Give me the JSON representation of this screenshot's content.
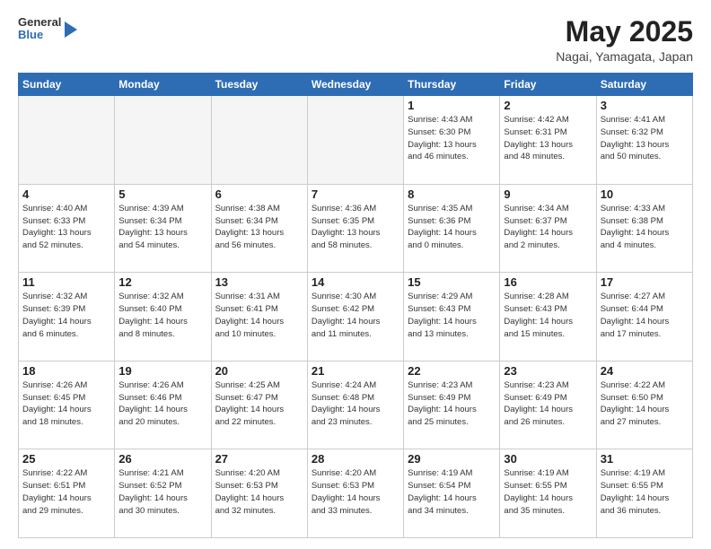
{
  "header": {
    "logo": {
      "line1": "General",
      "line2": "Blue"
    },
    "month": "May 2025",
    "location": "Nagai, Yamagata, Japan"
  },
  "weekdays": [
    "Sunday",
    "Monday",
    "Tuesday",
    "Wednesday",
    "Thursday",
    "Friday",
    "Saturday"
  ],
  "weeks": [
    [
      {
        "day": "",
        "info": ""
      },
      {
        "day": "",
        "info": ""
      },
      {
        "day": "",
        "info": ""
      },
      {
        "day": "",
        "info": ""
      },
      {
        "day": "1",
        "info": "Sunrise: 4:43 AM\nSunset: 6:30 PM\nDaylight: 13 hours\nand 46 minutes."
      },
      {
        "day": "2",
        "info": "Sunrise: 4:42 AM\nSunset: 6:31 PM\nDaylight: 13 hours\nand 48 minutes."
      },
      {
        "day": "3",
        "info": "Sunrise: 4:41 AM\nSunset: 6:32 PM\nDaylight: 13 hours\nand 50 minutes."
      }
    ],
    [
      {
        "day": "4",
        "info": "Sunrise: 4:40 AM\nSunset: 6:33 PM\nDaylight: 13 hours\nand 52 minutes."
      },
      {
        "day": "5",
        "info": "Sunrise: 4:39 AM\nSunset: 6:34 PM\nDaylight: 13 hours\nand 54 minutes."
      },
      {
        "day": "6",
        "info": "Sunrise: 4:38 AM\nSunset: 6:34 PM\nDaylight: 13 hours\nand 56 minutes."
      },
      {
        "day": "7",
        "info": "Sunrise: 4:36 AM\nSunset: 6:35 PM\nDaylight: 13 hours\nand 58 minutes."
      },
      {
        "day": "8",
        "info": "Sunrise: 4:35 AM\nSunset: 6:36 PM\nDaylight: 14 hours\nand 0 minutes."
      },
      {
        "day": "9",
        "info": "Sunrise: 4:34 AM\nSunset: 6:37 PM\nDaylight: 14 hours\nand 2 minutes."
      },
      {
        "day": "10",
        "info": "Sunrise: 4:33 AM\nSunset: 6:38 PM\nDaylight: 14 hours\nand 4 minutes."
      }
    ],
    [
      {
        "day": "11",
        "info": "Sunrise: 4:32 AM\nSunset: 6:39 PM\nDaylight: 14 hours\nand 6 minutes."
      },
      {
        "day": "12",
        "info": "Sunrise: 4:32 AM\nSunset: 6:40 PM\nDaylight: 14 hours\nand 8 minutes."
      },
      {
        "day": "13",
        "info": "Sunrise: 4:31 AM\nSunset: 6:41 PM\nDaylight: 14 hours\nand 10 minutes."
      },
      {
        "day": "14",
        "info": "Sunrise: 4:30 AM\nSunset: 6:42 PM\nDaylight: 14 hours\nand 11 minutes."
      },
      {
        "day": "15",
        "info": "Sunrise: 4:29 AM\nSunset: 6:43 PM\nDaylight: 14 hours\nand 13 minutes."
      },
      {
        "day": "16",
        "info": "Sunrise: 4:28 AM\nSunset: 6:43 PM\nDaylight: 14 hours\nand 15 minutes."
      },
      {
        "day": "17",
        "info": "Sunrise: 4:27 AM\nSunset: 6:44 PM\nDaylight: 14 hours\nand 17 minutes."
      }
    ],
    [
      {
        "day": "18",
        "info": "Sunrise: 4:26 AM\nSunset: 6:45 PM\nDaylight: 14 hours\nand 18 minutes."
      },
      {
        "day": "19",
        "info": "Sunrise: 4:26 AM\nSunset: 6:46 PM\nDaylight: 14 hours\nand 20 minutes."
      },
      {
        "day": "20",
        "info": "Sunrise: 4:25 AM\nSunset: 6:47 PM\nDaylight: 14 hours\nand 22 minutes."
      },
      {
        "day": "21",
        "info": "Sunrise: 4:24 AM\nSunset: 6:48 PM\nDaylight: 14 hours\nand 23 minutes."
      },
      {
        "day": "22",
        "info": "Sunrise: 4:23 AM\nSunset: 6:49 PM\nDaylight: 14 hours\nand 25 minutes."
      },
      {
        "day": "23",
        "info": "Sunrise: 4:23 AM\nSunset: 6:49 PM\nDaylight: 14 hours\nand 26 minutes."
      },
      {
        "day": "24",
        "info": "Sunrise: 4:22 AM\nSunset: 6:50 PM\nDaylight: 14 hours\nand 27 minutes."
      }
    ],
    [
      {
        "day": "25",
        "info": "Sunrise: 4:22 AM\nSunset: 6:51 PM\nDaylight: 14 hours\nand 29 minutes."
      },
      {
        "day": "26",
        "info": "Sunrise: 4:21 AM\nSunset: 6:52 PM\nDaylight: 14 hours\nand 30 minutes."
      },
      {
        "day": "27",
        "info": "Sunrise: 4:20 AM\nSunset: 6:53 PM\nDaylight: 14 hours\nand 32 minutes."
      },
      {
        "day": "28",
        "info": "Sunrise: 4:20 AM\nSunset: 6:53 PM\nDaylight: 14 hours\nand 33 minutes."
      },
      {
        "day": "29",
        "info": "Sunrise: 4:19 AM\nSunset: 6:54 PM\nDaylight: 14 hours\nand 34 minutes."
      },
      {
        "day": "30",
        "info": "Sunrise: 4:19 AM\nSunset: 6:55 PM\nDaylight: 14 hours\nand 35 minutes."
      },
      {
        "day": "31",
        "info": "Sunrise: 4:19 AM\nSunset: 6:55 PM\nDaylight: 14 hours\nand 36 minutes."
      }
    ]
  ]
}
